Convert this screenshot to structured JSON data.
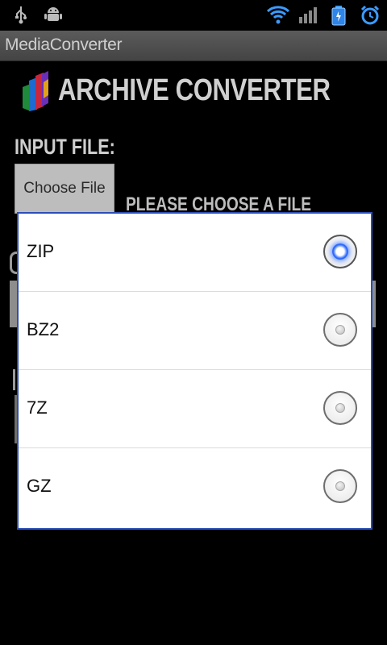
{
  "app": {
    "window_title": "MediaConverter",
    "title": "ARCHIVE CONVERTER"
  },
  "status_bar": {
    "icons": [
      "usb-icon",
      "android-debug-icon",
      "wifi-icon",
      "signal-icon",
      "battery-icon",
      "alarm-icon"
    ]
  },
  "form": {
    "input_label": "INPUT FILE:",
    "choose_button": "Choose File",
    "file_status": "PLEASE CHOOSE A FILE"
  },
  "dialog": {
    "options": [
      {
        "label": "ZIP",
        "selected": true
      },
      {
        "label": "BZ2",
        "selected": false
      },
      {
        "label": "7Z",
        "selected": false
      },
      {
        "label": "GZ",
        "selected": false
      }
    ]
  },
  "colors": {
    "accent": "#2f6cff",
    "dialog_border": "#2b4fb8",
    "background": "#000000"
  }
}
